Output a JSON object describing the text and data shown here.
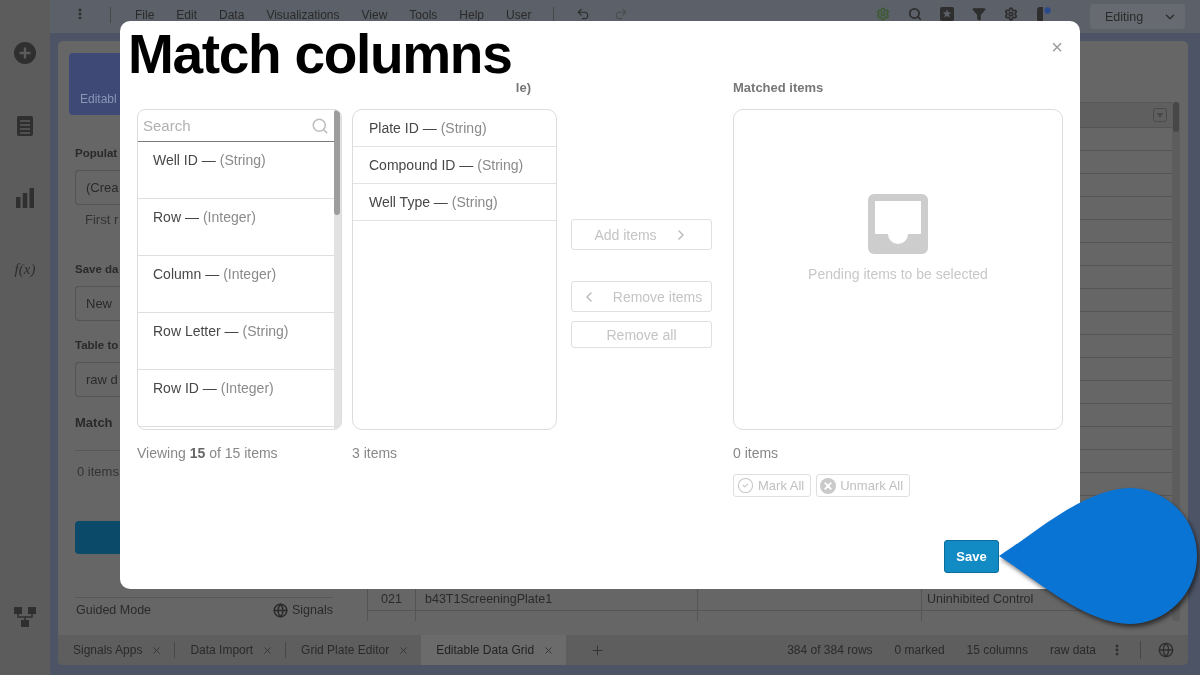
{
  "rail": {
    "formula": "f(x)"
  },
  "menu_bar": {
    "items": [
      "File",
      "Edit",
      "Data",
      "Visualizations",
      "View",
      "Tools",
      "Help",
      "User"
    ],
    "mode": "Editing"
  },
  "left_panel": {
    "card": "Editabl",
    "fields": [
      {
        "label": "Populat",
        "value": "(Crea",
        "hint": "First r"
      },
      {
        "label": "Save da",
        "value": "New"
      },
      {
        "label": "Table to",
        "value": "raw d"
      }
    ],
    "section": "Match",
    "count": "0 items",
    "footer": {
      "mode": "Guided Mode",
      "brand": "Signals"
    }
  },
  "grid": {
    "rows": [
      {
        "column_1": "021",
        "column_2": "b43T1ScreeningPlate1",
        "column_4": "Uninhibited Control"
      }
    ]
  },
  "tabs": [
    {
      "label": "Signals Apps",
      "selected": false
    },
    {
      "label": "Data Import",
      "selected": false
    },
    {
      "label": "Grid Plate Editor",
      "selected": false
    },
    {
      "label": "Editable Data Grid",
      "selected": true
    }
  ],
  "status_bar": [
    "384 of 384 rows",
    "0 marked",
    "15 columns",
    "raw data"
  ],
  "dialog": {
    "title": "Match columns",
    "close": "×",
    "source": {
      "placeholder": "Search",
      "items": [
        {
          "name": "Well ID —",
          "type": "(String)"
        },
        {
          "name": "Row —",
          "type": "(Integer)"
        },
        {
          "name": "Column —",
          "type": "(Integer)"
        },
        {
          "name": "Row Letter —",
          "type": "(String)"
        },
        {
          "name": "Row ID —",
          "type": "(Integer)"
        }
      ],
      "footer": "Viewing **15** of 15 items"
    },
    "target": {
      "header": "le)",
      "items": [
        {
          "name": "Plate ID —",
          "type": "(String)"
        },
        {
          "name": "Compound ID —",
          "type": "(String)"
        },
        {
          "name": "Well Type —",
          "type": "(String)"
        }
      ],
      "footer": "3 items"
    },
    "actions": [
      {
        "kind": "add",
        "label": "Add items",
        "disabled": true
      },
      {
        "kind": "remove",
        "label": "Remove items",
        "disabled": true
      },
      {
        "kind": "remove_all",
        "label": "Remove all",
        "disabled": true
      }
    ],
    "matched": {
      "header": "Matched items",
      "empty_text": "Pending items to be selected",
      "footer": "0 items",
      "buttons": [
        {
          "kind": "mark",
          "label": "Mark All",
          "disabled": true
        },
        {
          "kind": "unmark",
          "label": "Unmark All",
          "disabled": true
        }
      ]
    },
    "save": "Save"
  }
}
